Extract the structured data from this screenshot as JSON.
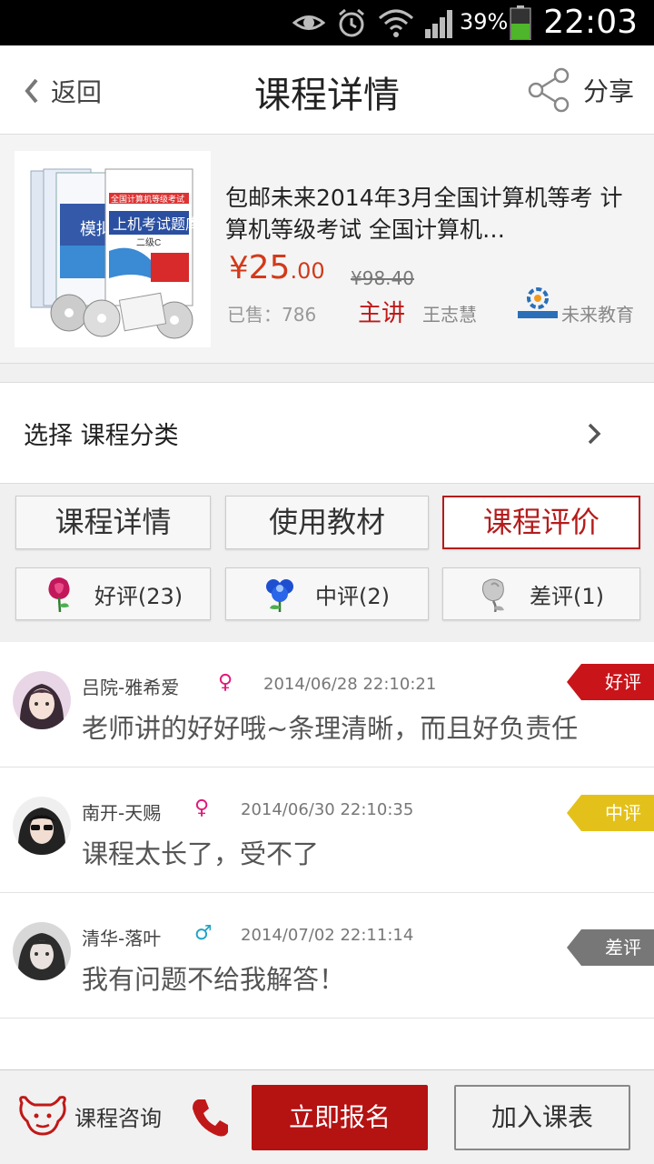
{
  "status_bar": {
    "battery": "39%",
    "time": "22:03"
  },
  "nav": {
    "back_label": "返回",
    "title": "课程详情",
    "share_label": "分享"
  },
  "product": {
    "name": "包邮未来2014年3月全国计算机等考 计算机等级考试 全国计算机…",
    "price_symbol": "¥",
    "price_int": "25",
    "price_dec": ".00",
    "price_old": "¥98.40",
    "sold": "已售：786",
    "lecturer_label": "主讲",
    "lecturer_name": "王志慧",
    "org_name": "未来教育",
    "cover_text": {
      "line1": "全国计算机等级考试",
      "line2": "上机考试题库",
      "line3": "模拟",
      "line4": "二级C"
    }
  },
  "category": {
    "label": "选择 课程分类"
  },
  "tabs": [
    {
      "label": "课程详情",
      "active": false
    },
    {
      "label": "使用教材",
      "active": false
    },
    {
      "label": "课程评价",
      "active": true
    }
  ],
  "filters": [
    {
      "label": "好评(23)",
      "icon": "rose-icon"
    },
    {
      "label": "中评(2)",
      "icon": "blue-flower-icon"
    },
    {
      "label": "差评(1)",
      "icon": "wilted-flower-icon"
    }
  ],
  "reviews": [
    {
      "user": "吕院-雅希爱",
      "gender": "♀",
      "time": "2014/06/28  22:10:21",
      "text": "老师讲的好好哦~条理清晰，而且好负责任",
      "badge": "好评",
      "badge_color": "#c9151a"
    },
    {
      "user": "南开-天赐",
      "gender": "♀",
      "time": "2014/06/30  22:10:35",
      "text": "课程太长了，受不了",
      "badge": "中评",
      "badge_color": "#e3c11a"
    },
    {
      "user": "清华-落叶",
      "gender": "♂",
      "time": "2014/07/02  22:11:14",
      "text": "我有问题不给我解答！",
      "badge": "差评",
      "badge_color": "#777777"
    }
  ],
  "bottom": {
    "consult_label": "课程咨询",
    "enroll_label": "立即报名",
    "add_label": "加入课表"
  },
  "colors": {
    "accent": "#b51212",
    "price": "#d23a1a",
    "female": "#e0187a",
    "male": "#22a3c8"
  }
}
